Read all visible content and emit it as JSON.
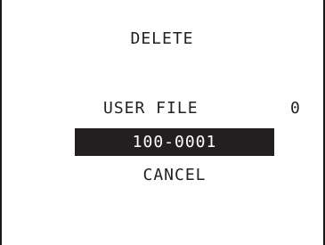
{
  "screen": {
    "title": "DELETE"
  },
  "menu": {
    "user_file_label": "USER FILE",
    "user_file_count": "0",
    "selected_entry": "100-0001",
    "cancel_label": "CANCEL"
  }
}
